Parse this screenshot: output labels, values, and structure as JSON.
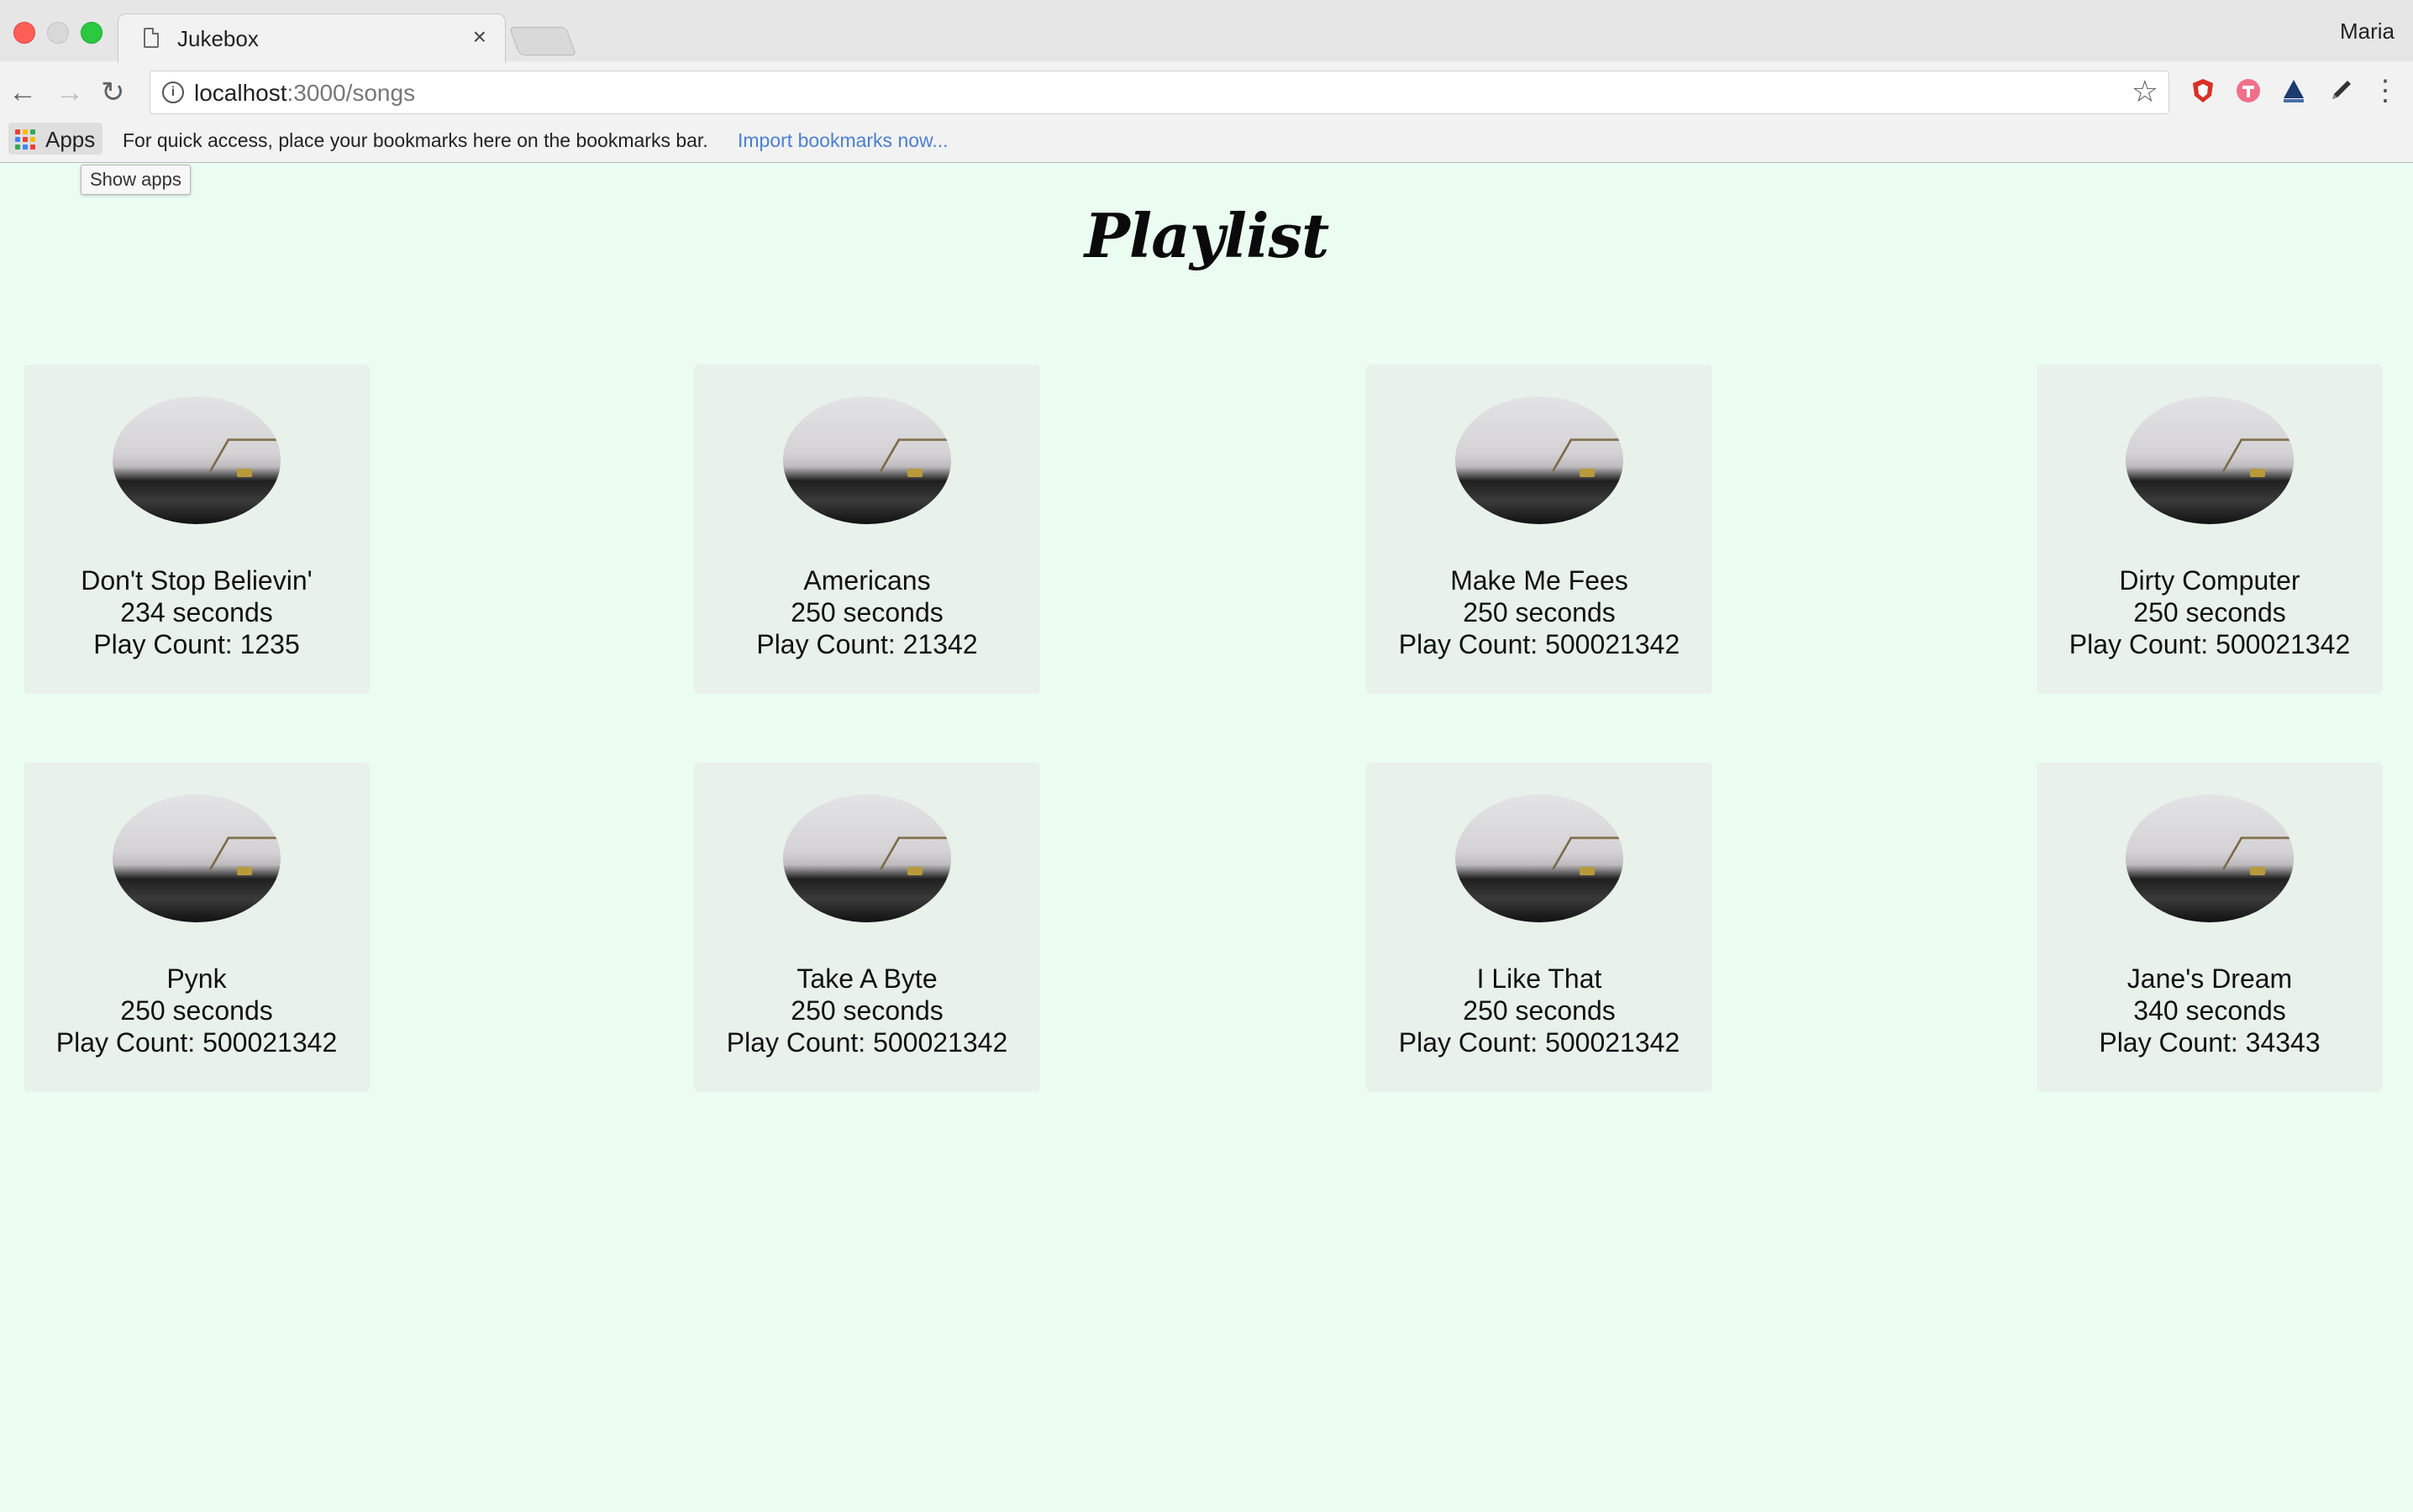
{
  "browser": {
    "tab_title": "Jukebox",
    "tab_close": "×",
    "profile_name": "Maria",
    "url_host": "localhost",
    "url_path": ":3000/songs",
    "bookmarks": {
      "apps_label": "Apps",
      "message": "For quick access, place your bookmarks here on the bookmarks bar.",
      "import_link": "Import bookmarks now..."
    },
    "tooltip": "Show apps"
  },
  "page": {
    "title": "Playlist"
  },
  "songs": [
    {
      "name": "Don't Stop Believin'",
      "duration": "234 seconds",
      "play_count": "Play Count: 1235"
    },
    {
      "name": "Americans",
      "duration": "250 seconds",
      "play_count": "Play Count: 21342"
    },
    {
      "name": "Make Me Fees",
      "duration": "250 seconds",
      "play_count": "Play Count: 500021342"
    },
    {
      "name": "Dirty Computer",
      "duration": "250 seconds",
      "play_count": "Play Count: 500021342"
    },
    {
      "name": "Pynk",
      "duration": "250 seconds",
      "play_count": "Play Count: 500021342"
    },
    {
      "name": "Take A Byte",
      "duration": "250 seconds",
      "play_count": "Play Count: 500021342"
    },
    {
      "name": "I Like That",
      "duration": "250 seconds",
      "play_count": "Play Count: 500021342"
    },
    {
      "name": "Jane's Dream",
      "duration": "340 seconds",
      "play_count": "Play Count: 34343"
    }
  ],
  "colors": {
    "page_background": "#ebfcf1",
    "card_background": "#e8f1ea",
    "link": "#4a7fd0"
  }
}
